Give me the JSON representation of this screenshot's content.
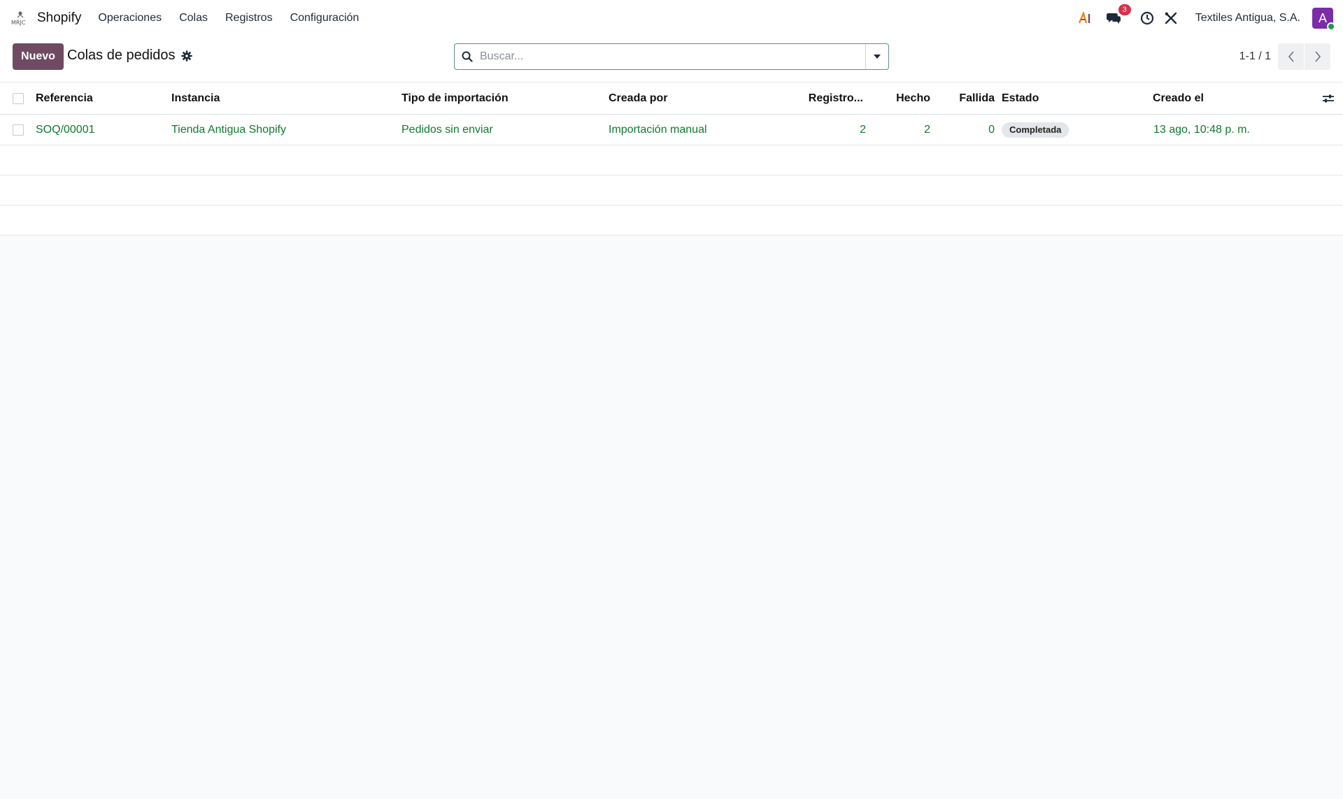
{
  "navbar": {
    "app_name": "Shopify",
    "menu": [
      "Operaciones",
      "Colas",
      "Registros",
      "Configuración"
    ],
    "chat_badge": "3",
    "company": "Textiles Antigua, S.A.",
    "avatar_initial": "A"
  },
  "control_panel": {
    "new_button": "Nuevo",
    "title": "Colas de pedidos",
    "search_placeholder": "Buscar...",
    "pager": "1-1 / 1"
  },
  "table": {
    "columns": {
      "reference": "Referencia",
      "instance": "Instancia",
      "import_type": "Tipo de importación",
      "created_by": "Creada por",
      "records": "Registro...",
      "done": "Hecho",
      "failed": "Fallida",
      "state": "Estado",
      "created_on": "Creado el"
    },
    "rows": [
      {
        "reference": "SOQ/00001",
        "instance": "Tienda Antigua Shopify",
        "import_type": "Pedidos sin enviar",
        "created_by": "Importación manual",
        "records": "2",
        "done": "2",
        "failed": "0",
        "state": "Completada",
        "created_on": "13 ago, 10:48 p. m."
      }
    ]
  },
  "colors": {
    "primary": "#6f4a62",
    "link": "#0f7a2f",
    "badge": "#d6304a",
    "avatar": "#7b2ca8"
  }
}
